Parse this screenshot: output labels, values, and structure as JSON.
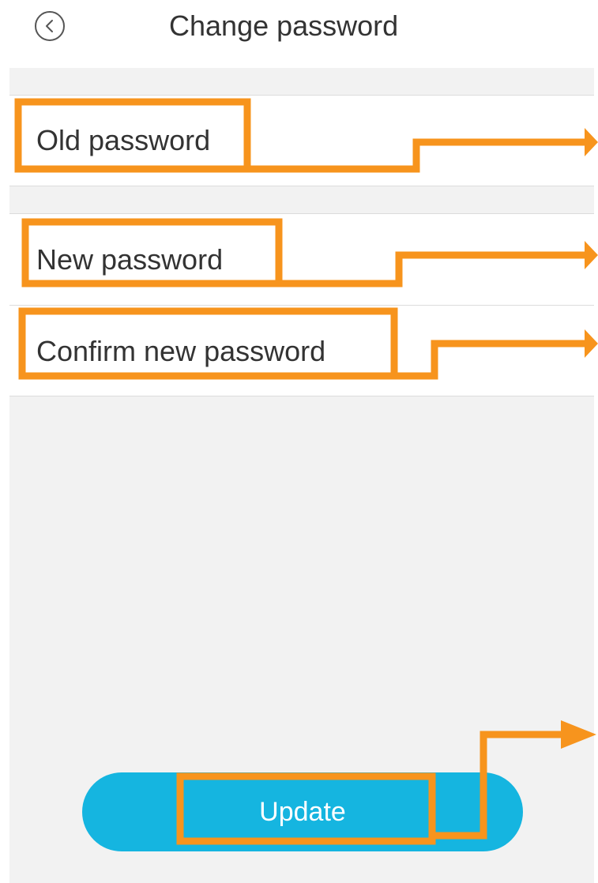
{
  "header": {
    "title": "Change password",
    "back_icon": "chevron-left-icon"
  },
  "form": {
    "old_password_placeholder": "Old password",
    "new_password_placeholder": "New password",
    "confirm_password_placeholder": "Confirm new password",
    "update_label": "Update"
  },
  "colors": {
    "button": "#15b5e0",
    "annotation": "#f7941d",
    "background": "#f2f2f2"
  }
}
